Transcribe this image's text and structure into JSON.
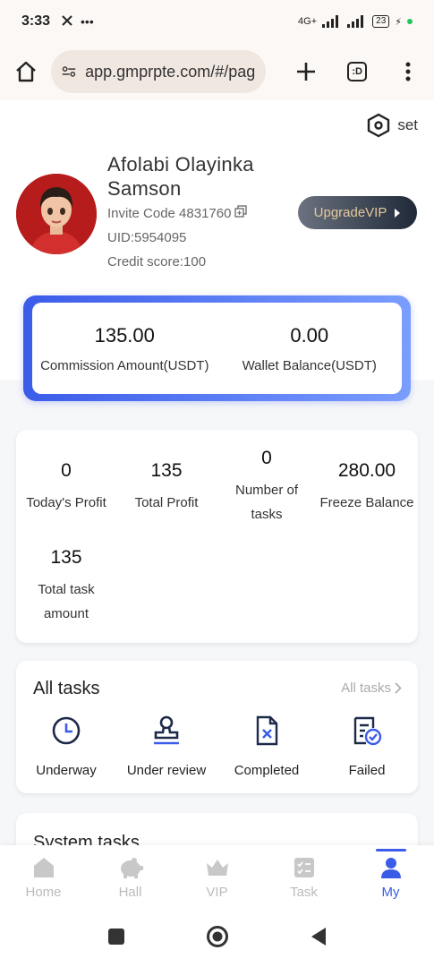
{
  "status_bar": {
    "time": "3:33",
    "left_icons": [
      "x-icon",
      "more-dots-icon"
    ],
    "network": "4G+",
    "battery": "23"
  },
  "browser": {
    "url": "app.gmprpte.com/#/pag",
    "tab_count": ":D"
  },
  "profile": {
    "set_label": "set",
    "name": "Afolabi Olayinka Samson",
    "invite_code": "Invite Code 4831760",
    "uid": "UID:5954095",
    "credit_score": "Credit score:100",
    "upgrade_label": "UpgradeVIP"
  },
  "balances": [
    {
      "value": "135.00",
      "label": "Commission Amount(USDT)"
    },
    {
      "value": "0.00",
      "label": "Wallet Balance(USDT)"
    }
  ],
  "stats": [
    {
      "value": "0",
      "label": "Today's Profit"
    },
    {
      "value": "135",
      "label": "Total Profit"
    },
    {
      "value": "0",
      "label": "Number of tasks"
    },
    {
      "value": "280.00",
      "label": "Freeze Balance"
    },
    {
      "value": "135",
      "label": "Total task amount"
    }
  ],
  "all_tasks": {
    "title": "All tasks",
    "link": "All tasks",
    "items": [
      {
        "label": "Underway",
        "icon": "clock-icon"
      },
      {
        "label": "Under review",
        "icon": "stamp-icon"
      },
      {
        "label": "Completed",
        "icon": "file-x-icon"
      },
      {
        "label": "Failed",
        "icon": "checklist-icon"
      }
    ]
  },
  "system_tasks": {
    "title": "System tasks"
  },
  "bottom_nav": [
    {
      "label": "Home",
      "icon": "home-icon",
      "active": false
    },
    {
      "label": "Hall",
      "icon": "piggy-bank-icon",
      "active": false
    },
    {
      "label": "VIP",
      "icon": "crown-icon",
      "active": false
    },
    {
      "label": "Task",
      "icon": "task-list-icon",
      "active": false
    },
    {
      "label": "My",
      "icon": "person-icon",
      "active": true
    }
  ],
  "colors": {
    "accent": "#3b5ce8",
    "vip_text": "#e5c89f"
  }
}
